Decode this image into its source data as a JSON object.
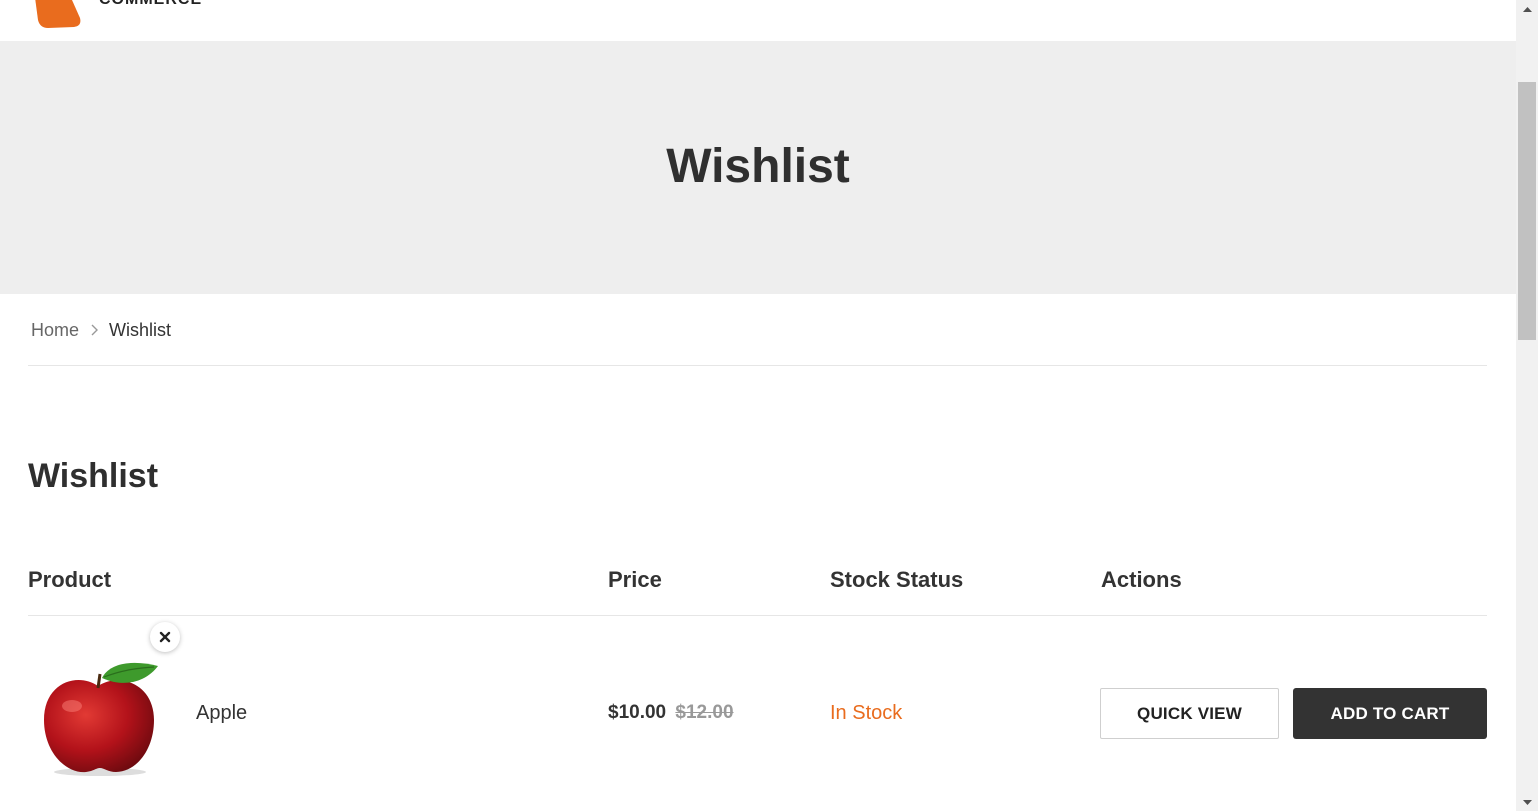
{
  "header": {
    "logo_text": "COMMERCE",
    "accent_color": "#e96c1e"
  },
  "hero": {
    "title": "Wishlist"
  },
  "breadcrumb": {
    "home": "Home",
    "current": "Wishlist"
  },
  "section": {
    "title": "Wishlist"
  },
  "table": {
    "headers": {
      "product": "Product",
      "price": "Price",
      "stock": "Stock Status",
      "actions": "Actions"
    },
    "rows": [
      {
        "name": "Apple",
        "image_icon": "apple-image",
        "price_current": "$10.00",
        "price_old": "$12.00",
        "stock": "In Stock",
        "quick_view": "QUICK VIEW",
        "add_to_cart": "ADD TO CART"
      }
    ]
  }
}
